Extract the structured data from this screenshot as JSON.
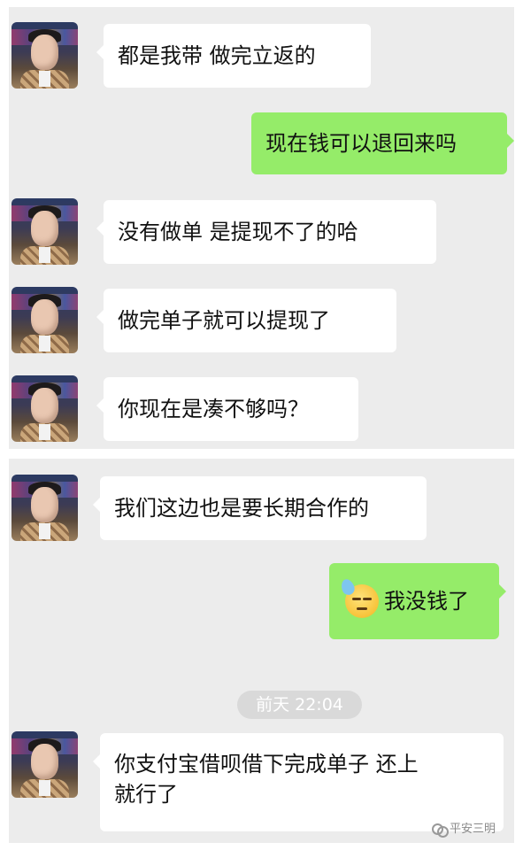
{
  "panels": [
    {
      "messages": [
        {
          "side": "left",
          "text": "都是我带  做完立返的"
        },
        {
          "side": "right",
          "text": "现在钱可以退回来吗"
        },
        {
          "side": "left",
          "text": "没有做单  是提现不了的哈"
        },
        {
          "side": "left",
          "text": "做完单子就可以提现了"
        },
        {
          "side": "left",
          "text": "你现在是凑不够吗？"
        }
      ]
    },
    {
      "messages": [
        {
          "side": "left",
          "text": "我们这边也是要长期合作的"
        },
        {
          "side": "right",
          "emoji": "sweat-face",
          "text": "我没钱了"
        },
        {
          "side": "left",
          "text_line1": "你支付宝借呗借下完成单子  还上",
          "text_line2": "就行了"
        }
      ],
      "timestamp": "前天 22:04"
    }
  ],
  "watermark": {
    "text": "平安三明"
  },
  "colors": {
    "sent_bubble": "#95ec69",
    "received_bubble": "#ffffff",
    "chat_background": "#ececec"
  }
}
